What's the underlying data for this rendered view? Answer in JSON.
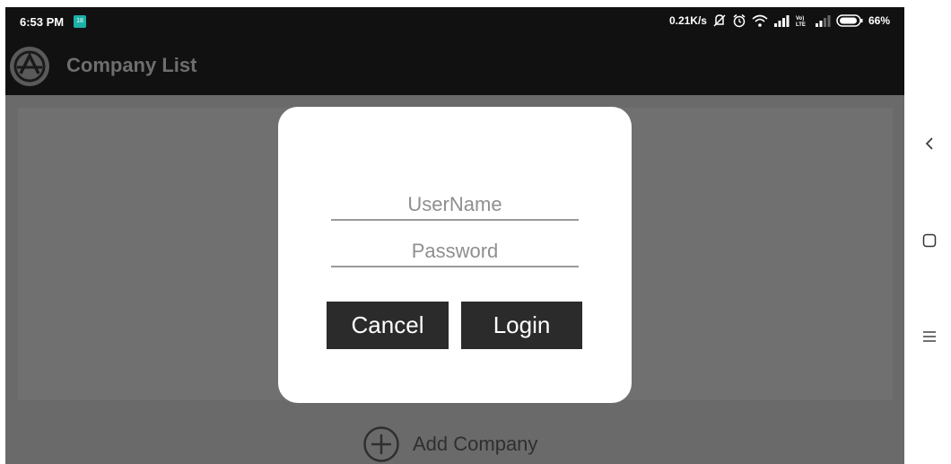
{
  "status_bar": {
    "time": "6:53 PM",
    "notification_badge": "18",
    "network_speed": "0.21K/s",
    "battery": "66%",
    "icons": [
      "mute-icon",
      "alarm-icon",
      "wifi-icon",
      "signal-icon",
      "volte-icon",
      "signal-weak-icon",
      "battery-icon"
    ]
  },
  "app_bar": {
    "title": "Company List",
    "logo_icon": "company-logo-icon"
  },
  "dialog": {
    "username_placeholder": "UserName",
    "password_placeholder": "Password",
    "username_value": "",
    "password_value": "",
    "cancel_label": "Cancel",
    "login_label": "Login"
  },
  "footer": {
    "add_company_label": "Add Company",
    "add_icon": "plus-circle-icon"
  },
  "nav_bar": {
    "icons": [
      "back-icon",
      "home-icon",
      "menu-icon"
    ]
  },
  "colors": {
    "bar_bg": "#111111",
    "overlay_bg": "#6a6a6a",
    "button_bg": "#2b2b2b",
    "dialog_bg": "#ffffff"
  }
}
